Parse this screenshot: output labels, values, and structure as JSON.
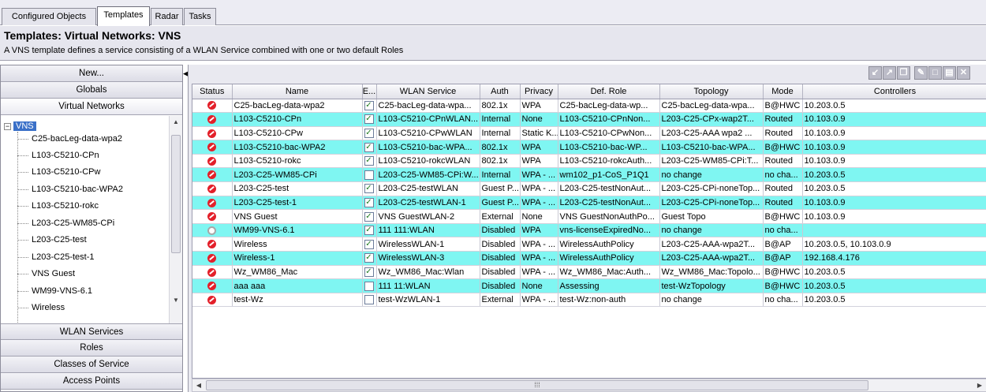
{
  "tabs": [
    "Configured Objects",
    "Templates",
    "Radar",
    "Tasks"
  ],
  "active_tab": "Templates",
  "header": {
    "title": "Templates: Virtual Networks: VNS",
    "description": "A VNS template defines a service consisting of a WLAN Service combined with one or two default Roles"
  },
  "sidebar": {
    "top_buttons": [
      "New...",
      "Globals",
      "Virtual Networks"
    ],
    "tree_root": "VNS",
    "tree_items": [
      "C25-bacLeg-data-wpa2",
      "L103-C5210-CPn",
      "L103-C5210-CPw",
      "L103-C5210-bac-WPA2",
      "L103-C5210-rokc",
      "L203-C25-WM85-CPi",
      "L203-C25-test",
      "L203-C25-test-1",
      "VNS Guest",
      "WM99-VNS-6.1",
      "Wireless"
    ],
    "bottom_buttons": [
      "WLAN Services",
      "Roles",
      "Classes of Service",
      "Access Points"
    ]
  },
  "toolbar_icons": [
    "import-icon",
    "export-icon",
    "copy-icon",
    "edit-icon",
    "new-icon",
    "save-icon",
    "delete-icon"
  ],
  "table": {
    "columns": [
      "Status",
      "Name",
      "E...",
      "WLAN Service",
      "Auth",
      "Privacy",
      "Def. Role",
      "Topology",
      "Mode",
      "Controllers"
    ],
    "rows": [
      {
        "status": "error",
        "name": "C25-bacLeg-data-wpa2",
        "enabled": true,
        "wlan": "C25-bacLeg-data-wpa...",
        "auth": "802.1x",
        "privacy": "WPA",
        "role": "C25-bacLeg-data-wp...",
        "topology": "C25-bacLeg-data-wpa...",
        "mode": "B@HWC",
        "controllers": "10.203.0.5"
      },
      {
        "status": "error",
        "name": "L103-C5210-CPn",
        "enabled": true,
        "wlan": "L103-C5210-CPnWLAN...",
        "auth": "Internal",
        "privacy": "None",
        "role": "L103-C5210-CPnNon...",
        "topology": "L203-C25-CPx-wap2T...",
        "mode": "Routed",
        "controllers": "10.103.0.9"
      },
      {
        "status": "error",
        "name": "L103-C5210-CPw",
        "enabled": true,
        "wlan": "L103-C5210-CPwWLAN",
        "auth": "Internal",
        "privacy": "Static K...",
        "role": "L103-C5210-CPwNon...",
        "topology": "L203-C25-AAA wpa2 ...",
        "mode": "Routed",
        "controllers": "10.103.0.9"
      },
      {
        "status": "error",
        "name": "L103-C5210-bac-WPA2",
        "enabled": true,
        "wlan": "L103-C5210-bac-WPA...",
        "auth": "802.1x",
        "privacy": "WPA",
        "role": "L103-C5210-bac-WP...",
        "topology": "L103-C5210-bac-WPA...",
        "mode": "B@HWC",
        "controllers": "10.103.0.9"
      },
      {
        "status": "error",
        "name": "L103-C5210-rokc",
        "enabled": true,
        "wlan": "L103-C5210-rokcWLAN",
        "auth": "802.1x",
        "privacy": "WPA",
        "role": "L103-C5210-rokcAuth...",
        "topology": "L203-C25-WM85-CPi:T...",
        "mode": "Routed",
        "controllers": "10.103.0.9"
      },
      {
        "status": "error",
        "name": "L203-C25-WM85-CPi",
        "enabled": false,
        "wlan": "L203-C25-WM85-CPi:W...",
        "auth": "Internal",
        "privacy": "WPA - ...",
        "role": "wm102_p1-CoS_P1Q1",
        "topology": "no change",
        "mode": "no cha...",
        "controllers": "10.203.0.5"
      },
      {
        "status": "error",
        "name": "L203-C25-test",
        "enabled": true,
        "wlan": "L203-C25-testWLAN",
        "auth": "Guest P...",
        "privacy": "WPA - ...",
        "role": "L203-C25-testNonAut...",
        "topology": "L203-C25-CPi-noneTop...",
        "mode": "Routed",
        "controllers": "10.203.0.5"
      },
      {
        "status": "error",
        "name": "L203-C25-test-1",
        "enabled": true,
        "wlan": "L203-C25-testWLAN-1",
        "auth": "Guest P...",
        "privacy": "WPA - ...",
        "role": "L203-C25-testNonAut...",
        "topology": "L203-C25-CPi-noneTop...",
        "mode": "Routed",
        "controllers": "10.103.0.9"
      },
      {
        "status": "error",
        "name": "VNS Guest",
        "enabled": true,
        "wlan": "VNS GuestWLAN-2",
        "auth": "External",
        "privacy": "None",
        "role": "VNS GuestNonAuthPo...",
        "topology": "Guest Topo",
        "mode": "B@HWC",
        "controllers": "10.103.0.9"
      },
      {
        "status": "disabled",
        "name": "WM99-VNS-6.1",
        "enabled": true,
        "wlan": "111 111:WLAN",
        "auth": "Disabled",
        "privacy": "WPA",
        "role": "vns-licenseExpiredNo...",
        "topology": "no change",
        "mode": "no cha...",
        "controllers": ""
      },
      {
        "status": "error",
        "name": "Wireless",
        "enabled": true,
        "wlan": "WirelessWLAN-1",
        "auth": "Disabled",
        "privacy": "WPA - ...",
        "role": "WirelessAuthPolicy",
        "topology": "L203-C25-AAA-wpa2T...",
        "mode": "B@AP",
        "controllers": "10.203.0.5, 10.103.0.9"
      },
      {
        "status": "error",
        "name": "Wireless-1",
        "enabled": true,
        "wlan": "WirelessWLAN-3",
        "auth": "Disabled",
        "privacy": "WPA - ...",
        "role": "WirelessAuthPolicy",
        "topology": "L203-C25-AAA-wpa2T...",
        "mode": "B@AP",
        "controllers": "192.168.4.176"
      },
      {
        "status": "error",
        "name": "Wz_WM86_Mac",
        "enabled": true,
        "wlan": "Wz_WM86_Mac:Wlan",
        "auth": "Disabled",
        "privacy": "WPA - ...",
        "role": "Wz_WM86_Mac:Auth...",
        "topology": "Wz_WM86_Mac:Topolo...",
        "mode": "B@HWC",
        "controllers": "10.203.0.5"
      },
      {
        "status": "error",
        "name": "aaa aaa",
        "enabled": false,
        "wlan": "111 11:WLAN",
        "auth": "Disabled",
        "privacy": "None",
        "role": "Assessing",
        "topology": "test-WzTopology",
        "mode": "B@HWC",
        "controllers": "10.203.0.5"
      },
      {
        "status": "error",
        "name": "test-Wz",
        "enabled": false,
        "wlan": "test-WzWLAN-1",
        "auth": "External",
        "privacy": "WPA - ...",
        "role": "test-Wz:non-auth",
        "topology": "no change",
        "mode": "no cha...",
        "controllers": "10.203.0.5"
      }
    ]
  },
  "colors": {
    "alt_row": "#7ff6f2",
    "selected": "#3a70c8",
    "error": "#e3202a"
  }
}
